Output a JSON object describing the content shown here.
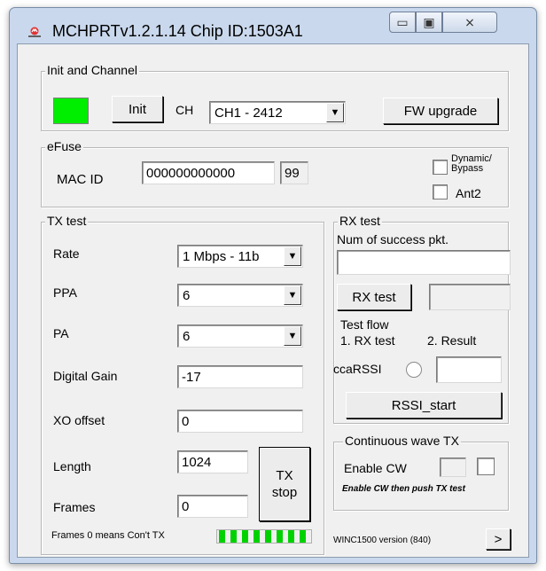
{
  "window": {
    "title": "MCHPRTv1.2.1.14 Chip ID:1503A1",
    "minimize_glyph": "▭",
    "maximize_glyph": "▣",
    "close_glyph": "⨯"
  },
  "init_channel": {
    "group_title": "Init and Channel",
    "init_label": "Init",
    "ch_label": "CH",
    "channel_value": "CH1 - 2412",
    "fw_upgrade_label": "FW upgrade",
    "status_color": "#00ee00"
  },
  "efuse": {
    "group_title": "eFuse",
    "mac_label": "MAC ID",
    "mac_value": "000000000000",
    "mac_suffix": "99",
    "dynamic_line1": "Dynamic/",
    "dynamic_line2": "Bypass",
    "ant2_label": "Ant2"
  },
  "tx_test": {
    "group_title": "TX test",
    "rate_label": "Rate",
    "rate_value": "1 Mbps - 11b",
    "ppa_label": "PPA",
    "ppa_value": "6",
    "pa_label": "PA",
    "pa_value": "6",
    "digital_gain_label": "Digital Gain",
    "digital_gain_value": "-17",
    "xo_offset_label": "XO offset",
    "xo_offset_value": "0",
    "length_label": "Length",
    "length_value": "1024",
    "frames_label": "Frames",
    "frames_value": "0",
    "tx_stop_line1": "TX",
    "tx_stop_line2": "stop",
    "frames_note": "Frames 0 means Con't TX",
    "progress_segments": 8,
    "progress_color": "#00d200"
  },
  "rx_test": {
    "group_title": "RX test",
    "num_success_label": "Num of success pkt.",
    "num_success_value": "",
    "rx_test_button": "RX test",
    "test_flow_label": "Test flow",
    "flow_step1": "1. RX test",
    "flow_step2": "2. Result",
    "cca_rssi_label": "ccaRSSI",
    "rssi_start_button": "RSSI_start"
  },
  "cw_tx": {
    "group_title": "Continuous wave TX",
    "enable_cw_label": "Enable CW",
    "hint": "Enable CW then push TX test"
  },
  "footer": {
    "version_text": "WINC1500 version (840)",
    "next_button": ">"
  }
}
